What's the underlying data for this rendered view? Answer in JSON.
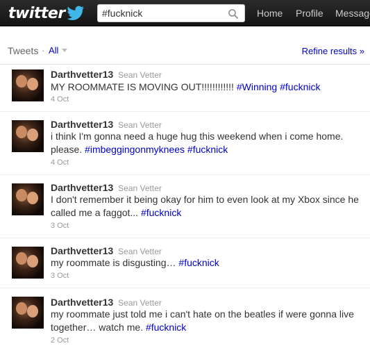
{
  "topbar": {
    "logo_text": "twitter",
    "search_value": "#fucknick",
    "nav": [
      "Home",
      "Profile",
      "Messages"
    ]
  },
  "header": {
    "title": "Tweets",
    "separator": "·",
    "filter": "All",
    "refine": "Refine results »"
  },
  "colors": {
    "link": "#0000cc",
    "topbar": "#1c1c1c"
  },
  "tweets": [
    {
      "screen_name": "Darthvetter13",
      "full_name": "Sean Vetter",
      "text_parts": [
        "MY ROOMMATE IS MOVING OUT!!!!!!!!!!!! ",
        "#Winning",
        " ",
        "#fucknick"
      ],
      "date": "4 Oct"
    },
    {
      "screen_name": "Darthvetter13",
      "full_name": "Sean Vetter",
      "text_parts": [
        "i think I'm gonna need a huge hug this weekend when i come home. please. ",
        "#imbeggingonmyknees",
        " ",
        "#fucknick"
      ],
      "date": "4 Oct"
    },
    {
      "screen_name": "Darthvetter13",
      "full_name": "Sean Vetter",
      "text_parts": [
        "I don't remember it being okay for him to even look at my Xbox since he called me a faggot... ",
        "#fucknick"
      ],
      "date": "3 Oct"
    },
    {
      "screen_name": "Darthvetter13",
      "full_name": "Sean Vetter",
      "text_parts": [
        "my roommate is disgusting… ",
        "#fucknick"
      ],
      "date": "3 Oct"
    },
    {
      "screen_name": "Darthvetter13",
      "full_name": "Sean Vetter",
      "text_parts": [
        "my roommate just told me i can't hate on the beatles if were gonna live together… watch me. ",
        "#fucknick"
      ],
      "date": "2 Oct"
    }
  ]
}
